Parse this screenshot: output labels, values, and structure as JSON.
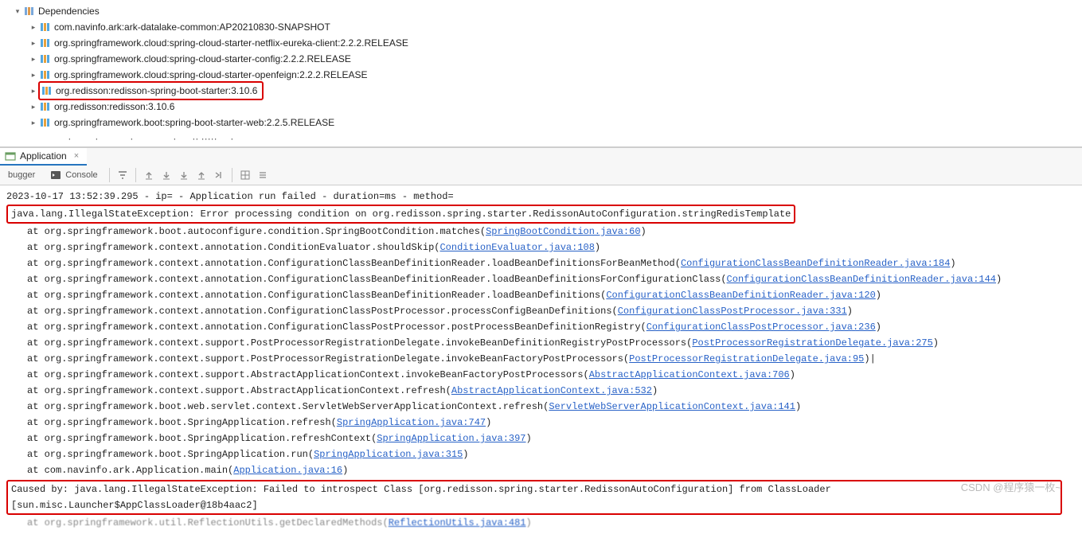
{
  "tree": {
    "root": "Dependencies",
    "items": [
      "com.navinfo.ark:ark-datalake-common:AP20210830-SNAPSHOT",
      "org.springframework.cloud:spring-cloud-starter-netflix-eureka-client:2.2.2.RELEASE",
      "org.springframework.cloud:spring-cloud-starter-config:2.2.2.RELEASE",
      "org.springframework.cloud:spring-cloud-starter-openfeign:2.2.2.RELEASE",
      "org.redisson:redisson-spring-boot-starter:3.10.6",
      "org.redisson:redisson:3.10.6",
      "org.springframework.boot:spring-boot-starter-web:2.2.5.RELEASE"
    ],
    "highlighted_index": 4
  },
  "tab": {
    "label": "Application",
    "close": "×"
  },
  "toolbar": {
    "debugger": "bugger",
    "console": "Console"
  },
  "console": {
    "log_line": "2023-10-17 13:52:39.295 - ip= - Application run failed - duration=ms - method=",
    "exception": "java.lang.IllegalStateException: Error processing condition on org.redisson.spring.starter.RedissonAutoConfiguration.stringRedisTemplate",
    "stack": [
      {
        "pre": "at org.springframework.boot.autoconfigure.condition.SpringBootCondition.matches(",
        "link": "SpringBootCondition.java:60",
        "post": ")"
      },
      {
        "pre": "at org.springframework.context.annotation.ConditionEvaluator.shouldSkip(",
        "link": "ConditionEvaluator.java:108",
        "post": ")"
      },
      {
        "pre": "at org.springframework.context.annotation.ConfigurationClassBeanDefinitionReader.loadBeanDefinitionsForBeanMethod(",
        "link": "ConfigurationClassBeanDefinitionReader.java:184",
        "post": ")"
      },
      {
        "pre": "at org.springframework.context.annotation.ConfigurationClassBeanDefinitionReader.loadBeanDefinitionsForConfigurationClass(",
        "link": "ConfigurationClassBeanDefinitionReader.java:144",
        "post": ")"
      },
      {
        "pre": "at org.springframework.context.annotation.ConfigurationClassBeanDefinitionReader.loadBeanDefinitions(",
        "link": "ConfigurationClassBeanDefinitionReader.java:120",
        "post": ")"
      },
      {
        "pre": "at org.springframework.context.annotation.ConfigurationClassPostProcessor.processConfigBeanDefinitions(",
        "link": "ConfigurationClassPostProcessor.java:331",
        "post": ")"
      },
      {
        "pre": "at org.springframework.context.annotation.ConfigurationClassPostProcessor.postProcessBeanDefinitionRegistry(",
        "link": "ConfigurationClassPostProcessor.java:236",
        "post": ")"
      },
      {
        "pre": "at org.springframework.context.support.PostProcessorRegistrationDelegate.invokeBeanDefinitionRegistryPostProcessors(",
        "link": "PostProcessorRegistrationDelegate.java:275",
        "post": ")"
      },
      {
        "pre": "at org.springframework.context.support.PostProcessorRegistrationDelegate.invokeBeanFactoryPostProcessors(",
        "link": "PostProcessorRegistrationDelegate.java:95",
        "post": ")|"
      },
      {
        "pre": "at org.springframework.context.support.AbstractApplicationContext.invokeBeanFactoryPostProcessors(",
        "link": "AbstractApplicationContext.java:706",
        "post": ")"
      },
      {
        "pre": "at org.springframework.context.support.AbstractApplicationContext.refresh(",
        "link": "AbstractApplicationContext.java:532",
        "post": ")"
      },
      {
        "pre": "at org.springframework.boot.web.servlet.context.ServletWebServerApplicationContext.refresh(",
        "link": "ServletWebServerApplicationContext.java:141",
        "post": ")"
      },
      {
        "pre": "at org.springframework.boot.SpringApplication.refresh(",
        "link": "SpringApplication.java:747",
        "post": ")"
      },
      {
        "pre": "at org.springframework.boot.SpringApplication.refreshContext(",
        "link": "SpringApplication.java:397",
        "post": ")"
      },
      {
        "pre": "at org.springframework.boot.SpringApplication.run(",
        "link": "SpringApplication.java:315",
        "post": ")"
      },
      {
        "pre": "at com.navinfo.ark.Application.main(",
        "link": "Application.java:16",
        "post": ")"
      }
    ],
    "caused_by": "Caused by: java.lang.IllegalStateException: Failed to introspect Class [org.redisson.spring.starter.RedissonAutoConfiguration] from ClassLoader [sun.misc.Launcher$AppClassLoader@18b4aac2]",
    "dim_line_pre": "at org.springframework.util.ReflectionUtils.getDeclaredMethods(",
    "dim_line_link": "ReflectionUtils.java:481",
    "dim_line_post": ")"
  },
  "watermark": "CSDN @程序猿一枚~"
}
